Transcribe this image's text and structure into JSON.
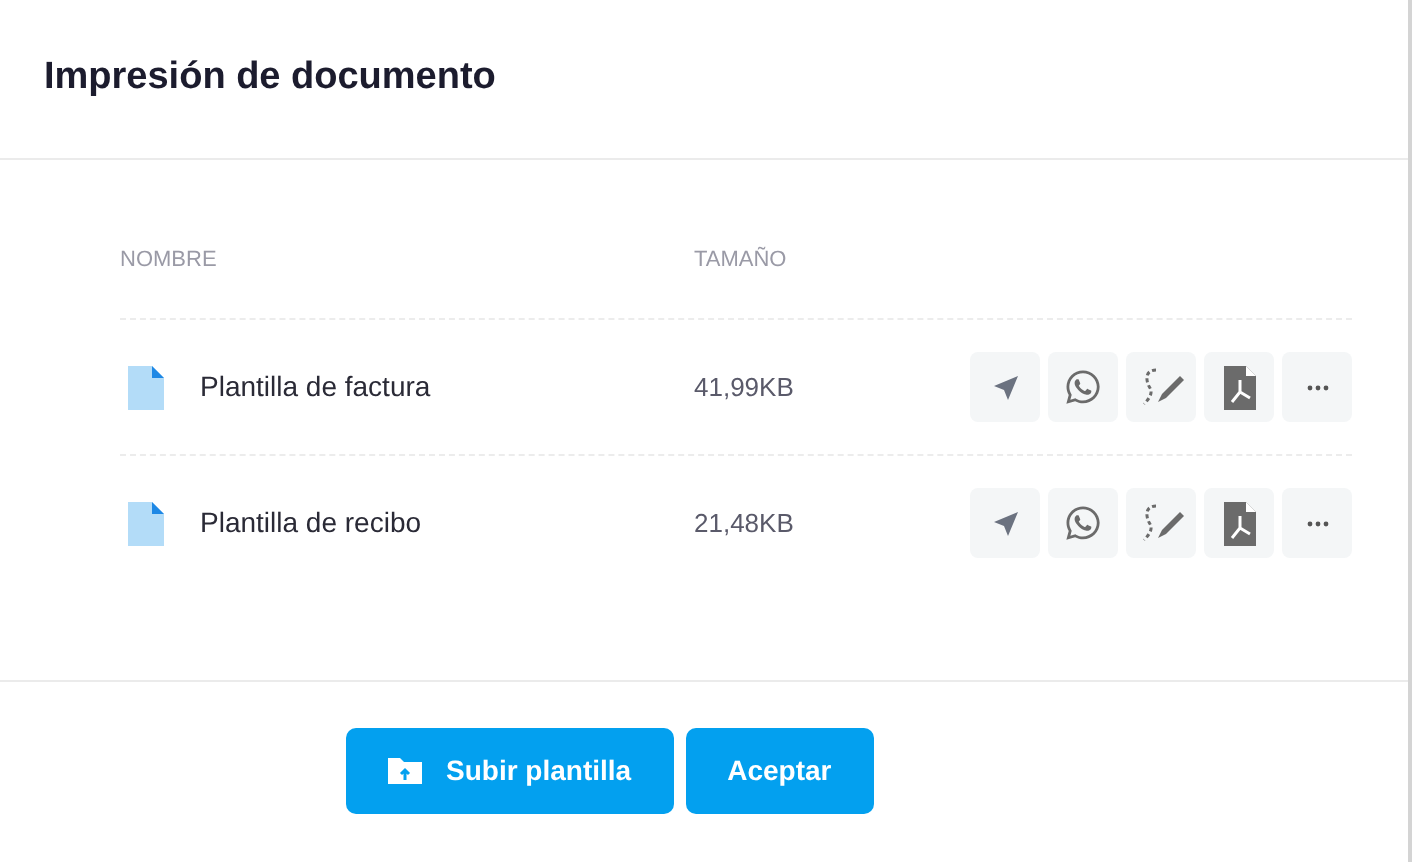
{
  "dialog": {
    "title": "Impresión de documento"
  },
  "table": {
    "columns": [
      "NOMBRE",
      "TAMAÑO"
    ],
    "rows": [
      {
        "name": "Plantilla de factura",
        "size": "41,99KB"
      },
      {
        "name": "Plantilla de recibo",
        "size": "21,48KB"
      }
    ]
  },
  "buttons": [
    {
      "kind": "upload",
      "label": "Subir plantilla"
    },
    {
      "kind": "plain",
      "label": "Aceptar"
    }
  ]
}
